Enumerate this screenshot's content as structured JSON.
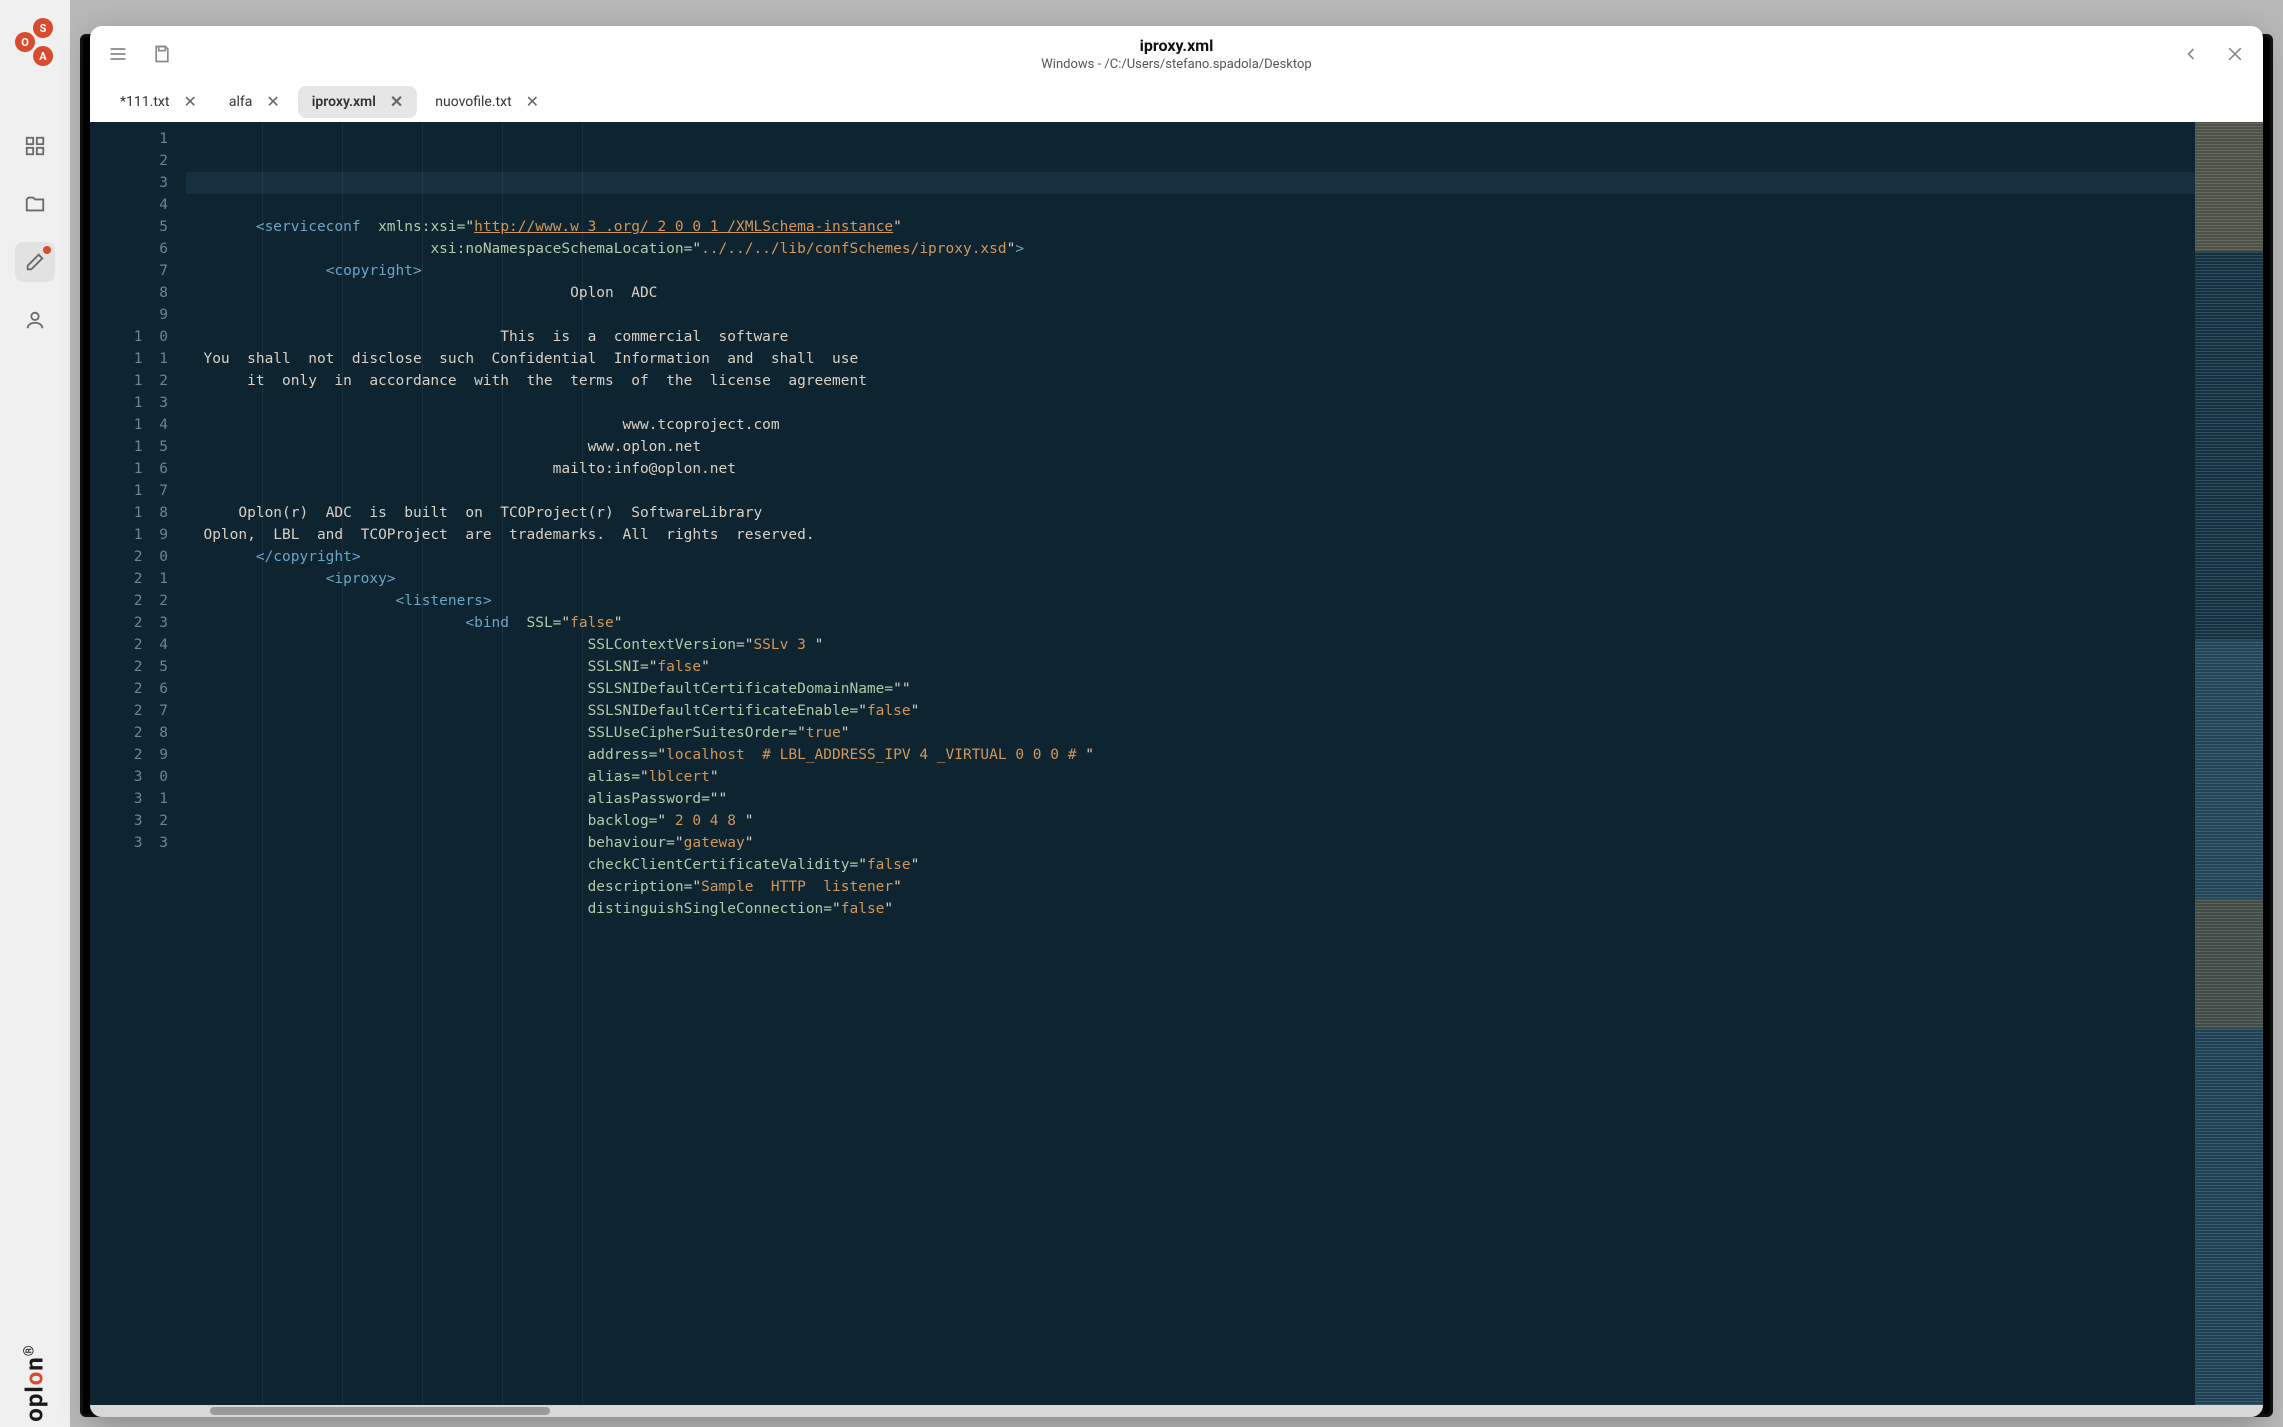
{
  "sidebar": {
    "logo": {
      "s": "S",
      "o": "O",
      "a": "A"
    },
    "brand": "oplon"
  },
  "window": {
    "title": "iproxy.xml",
    "subtitle": "Windows - /C:/Users/stefano.spadola/Desktop"
  },
  "tabs": [
    {
      "label": "*111.txt",
      "active": false
    },
    {
      "label": "alfa",
      "active": false
    },
    {
      "label": "iproxy.xml",
      "active": true
    },
    {
      "label": "nuovofile.txt",
      "active": false
    }
  ],
  "editor": {
    "line_start": 1,
    "line_end": 33,
    "code": {
      "l2_tag": "<serviceconf",
      "l2_attr": "xmlns:xsi=",
      "l2_url": "http://www.w 3 .org/ 2 0 0 1 /XMLSchema-instance",
      "l3_attr": "xsi:noNamespaceSchemaLocation=",
      "l3_val": "../../../lib/confSchemes/iproxy.xsd",
      "l4_tag": "<copyright>",
      "l5_txt": "Oplon  ADC",
      "l7_txt": "This  is  a  commercial  software",
      "l8_txt": "You  shall  not  disclose  such  Confidential  Information  and  shall  use",
      "l9_txt": "it  only  in  accordance  with  the  terms  of  the  license  agreement",
      "l11_txt": "www.tcoproject.com",
      "l12_txt": "www.oplon.net",
      "l13_txt": "mailto:info@oplon.net",
      "l15_txt": "Oplon(r)  ADC  is  built  on  TCOProject(r)  SoftwareLibrary",
      "l16_txt": "Oplon,  LBL  and  TCOProject  are  trademarks.  All  rights  reserved.",
      "l17_tag": "</copyright>",
      "l18_tag": "<iproxy>",
      "l19_tag": "<listeners>",
      "l20_tag": "<bind",
      "l20_attr": "SSL=",
      "l20_val": "false",
      "l21_attr": "SSLContextVersion=",
      "l21_val": "SSLv 3 ",
      "l22_attr": "SSLSNI=",
      "l22_val": "false",
      "l23_attr": "SSLSNIDefaultCertificateDomainName=",
      "l23_val": "",
      "l24_attr": "SSLSNIDefaultCertificateEnable=",
      "l24_val": "false",
      "l25_attr": "SSLUseCipherSuitesOrder=",
      "l25_val": "true",
      "l26_attr": "address=",
      "l26_val": "localhost  # LBL_ADDRESS_IPV 4 _VIRTUAL 0 0 0 # ",
      "l27_attr": "alias=",
      "l27_val": "lblcert",
      "l28_attr": "aliasPassword=",
      "l28_val": "",
      "l29_attr": "backlog=",
      "l29_val": " 2 0 4 8 ",
      "l30_attr": "behaviour=",
      "l30_val": "gateway",
      "l31_attr": "checkClientCertificateValidity=",
      "l31_val": "false",
      "l32_attr": "description=",
      "l32_val": "Sample  HTTP  listener",
      "l33_attr": "distinguishSingleConnection=",
      "l33_val": "false"
    }
  }
}
